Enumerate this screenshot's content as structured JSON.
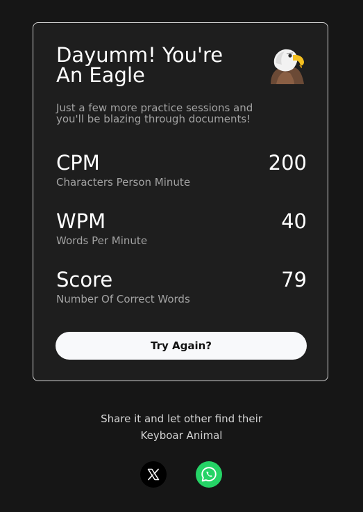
{
  "result": {
    "title": "Dayumm! You're An Eagle",
    "animal_icon": "eagle-icon",
    "subtitle": "Just a few more practice sessions and you'll be blazing through documents!"
  },
  "stats": [
    {
      "label": "CPM",
      "description": "Characters Person Minute",
      "value": "200"
    },
    {
      "label": "WPM",
      "description": "Words Per Minute",
      "value": "40"
    },
    {
      "label": "Score",
      "description": "Number Of Correct Words",
      "value": "79"
    }
  ],
  "actions": {
    "try_again_label": "Try Again?"
  },
  "share": {
    "line1": "Share it and let other find their",
    "line2": "Keyboar Animal",
    "buttons": [
      {
        "name": "x",
        "icon": "x-logo-icon",
        "color": "#000000"
      },
      {
        "name": "whatsapp",
        "icon": "whatsapp-icon",
        "color": "#25d366"
      }
    ]
  },
  "colors": {
    "background": "#161616",
    "card": "#1e1e1e",
    "muted_text": "#a3a3a3",
    "button_bg": "#f8f9fb"
  }
}
